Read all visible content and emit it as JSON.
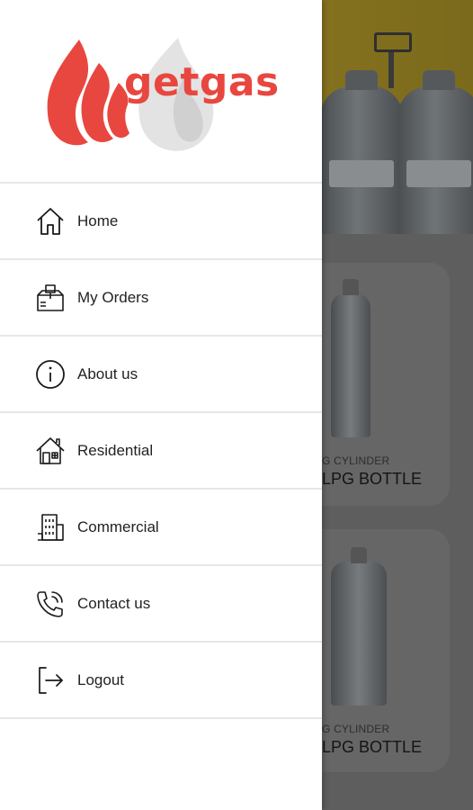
{
  "app": {
    "brand": "getgas",
    "brand_color": "#e8473f"
  },
  "drawer": {
    "items": [
      {
        "label": "Home",
        "icon": "home-icon"
      },
      {
        "label": "My Orders",
        "icon": "orders-box-icon"
      },
      {
        "label": "About us",
        "icon": "info-icon"
      },
      {
        "label": "Residential",
        "icon": "house-icon"
      },
      {
        "label": "Commercial",
        "icon": "building-icon"
      },
      {
        "label": "Contact us",
        "icon": "phone-call-icon"
      },
      {
        "label": "Logout",
        "icon": "logout-icon"
      }
    ]
  },
  "background": {
    "products": [
      {
        "category": "G CYLINDER",
        "title": "LPG BOTTLE"
      },
      {
        "category": "G CYLINDER",
        "title": "LPG BOTTLE"
      }
    ]
  }
}
